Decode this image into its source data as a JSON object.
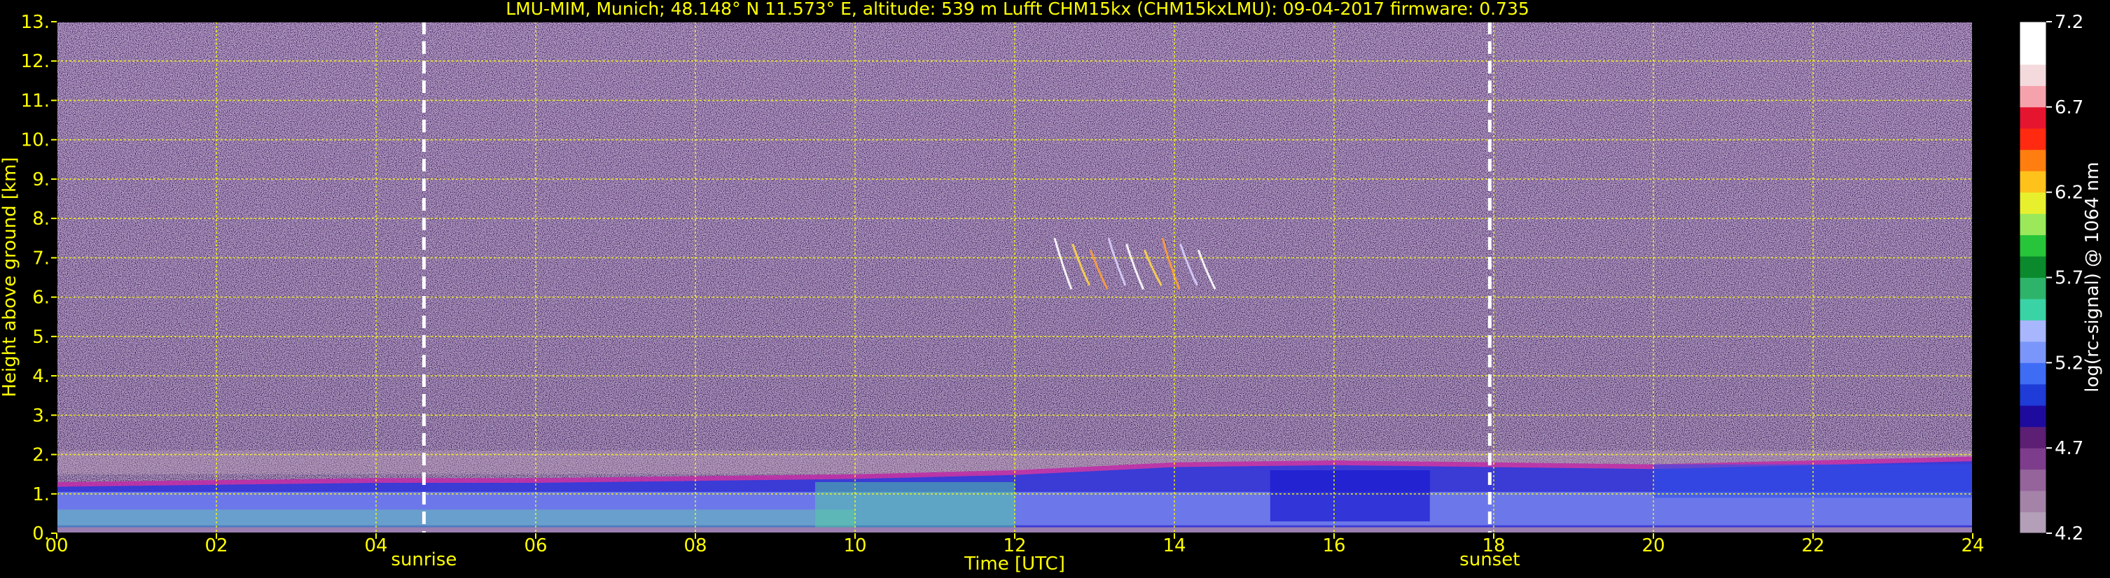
{
  "chart_data": {
    "type": "heatmap",
    "title": "LMU-MIM, Munich; 48.148° N 11.573° E, altitude: 539 m     Lufft CHM15kx (CHM15kxLMU): 09-04-2017     firmware: 0.735",
    "xlabel": "Time [UTC]",
    "ylabel": "Height above ground [km]",
    "xlim": [
      0,
      24
    ],
    "ylim": [
      0,
      13
    ],
    "x_ticks": [
      "00",
      "02",
      "04",
      "06",
      "08",
      "10",
      "12",
      "14",
      "16",
      "18",
      "20",
      "22",
      "24"
    ],
    "x_tick_values": [
      0,
      2,
      4,
      6,
      8,
      10,
      12,
      14,
      16,
      18,
      20,
      22,
      24
    ],
    "y_ticks": [
      "0.",
      "1.",
      "2.",
      "3.",
      "4.",
      "5.",
      "6.",
      "7.",
      "8.",
      "9.",
      "10.",
      "11.",
      "12.",
      "13."
    ],
    "y_tick_values": [
      0,
      1,
      2,
      3,
      4,
      5,
      6,
      7,
      8,
      9,
      10,
      11,
      12,
      13
    ],
    "grid": true,
    "vertical_markers": [
      {
        "label": "sunrise",
        "x": 4.6
      },
      {
        "label": "sunset",
        "x": 17.95
      }
    ],
    "colorbar": {
      "label": "log(rc-signal) @ 1064 nm",
      "ticks": [
        "4.2",
        "4.7",
        "5.2",
        "5.7",
        "6.2",
        "6.7",
        "7.2"
      ],
      "tick_values": [
        4.2,
        4.7,
        5.2,
        5.7,
        6.2,
        6.7,
        7.2
      ],
      "range": [
        4.2,
        7.2
      ]
    },
    "features": {
      "boundary_layer_top_km": [
        {
          "t": 0,
          "h": 1.3
        },
        {
          "t": 2,
          "h": 1.35
        },
        {
          "t": 4,
          "h": 1.4
        },
        {
          "t": 6,
          "h": 1.4
        },
        {
          "t": 8,
          "h": 1.45
        },
        {
          "t": 10,
          "h": 1.5
        },
        {
          "t": 12,
          "h": 1.6
        },
        {
          "t": 14,
          "h": 1.8
        },
        {
          "t": 16,
          "h": 1.85
        },
        {
          "t": 18,
          "h": 1.8
        },
        {
          "t": 20,
          "h": 1.75
        },
        {
          "t": 22,
          "h": 1.85
        },
        {
          "t": 24,
          "h": 1.95
        }
      ],
      "cirrus_streaks": {
        "t_start": 12.5,
        "t_end": 14.3,
        "h_min": 6.2,
        "h_max": 7.5
      }
    }
  },
  "colors": {
    "background": "#000000",
    "text": "#ffff00",
    "grid": "#ffff00",
    "noise": "#6e4f7e",
    "marker": "#ffffff",
    "colorbar_label": "#ffffff"
  }
}
